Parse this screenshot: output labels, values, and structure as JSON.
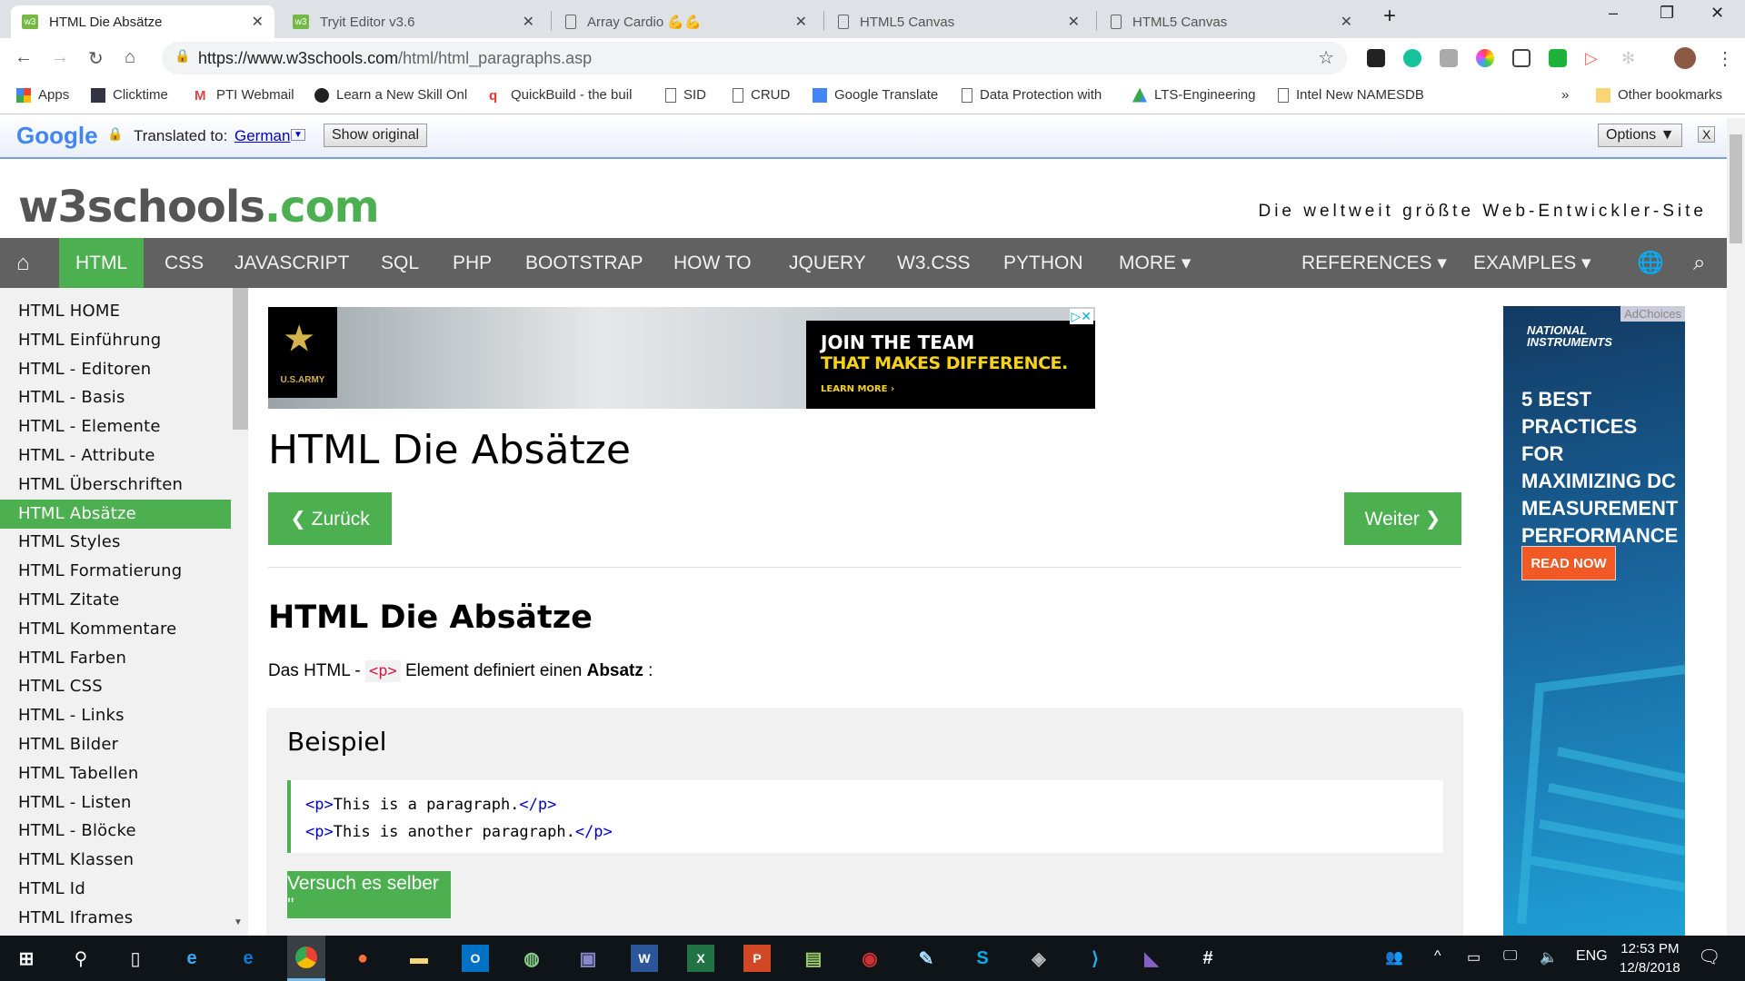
{
  "browser": {
    "tabs": [
      {
        "title": "HTML Die Absätze",
        "favicon": "w3",
        "active": true
      },
      {
        "title": "Tryit Editor v3.6",
        "favicon": "w3"
      },
      {
        "title": "Array Cardio 💪💪",
        "favicon": "page-icon"
      },
      {
        "title": "HTML5 Canvas",
        "favicon": "page-icon"
      },
      {
        "title": "HTML5 Canvas",
        "favicon": "page-icon"
      }
    ],
    "url_host": "https://www.w3schools.com",
    "url_path": "/html/html_paragraphs.asp",
    "bookmarks": [
      "Apps",
      "Clicktime",
      "PTI Webmail",
      "Learn a New Skill Onl",
      "QuickBuild - the buil",
      "SID",
      "CRUD",
      "Google Translate",
      "Data Protection with",
      "LTS-Engineering",
      "Intel New NAMESDB"
    ],
    "bookmarks_more": "»",
    "other_bookmarks": "Other bookmarks"
  },
  "translate": {
    "brand": "Google",
    "label": "Translated to:",
    "language": "German",
    "show_original": "Show original",
    "options": "Options ▼",
    "close": "X"
  },
  "site": {
    "logo_main": "w3schools",
    "logo_tld": ".com",
    "tagline": "Die weltweit größte Web-Entwickler-Site",
    "nav": [
      "HTML",
      "CSS",
      "JAVASCRIPT",
      "SQL",
      "PHP",
      "BOOTSTRAP",
      "HOW TO",
      "JQUERY",
      "W3.CSS",
      "PYTHON",
      "MORE ▾"
    ],
    "nav_right": [
      "REFERENCES ▾",
      "EXAMPLES ▾"
    ],
    "active_nav": "HTML",
    "accent": "#4caf50"
  },
  "sidebar": [
    "HTML HOME",
    "HTML Einführung",
    "HTML - Editoren",
    "HTML - Basis",
    "HTML - Elemente",
    "HTML - Attribute",
    "HTML Überschriften",
    "HTML Absätze",
    "HTML Styles",
    "HTML Formatierung",
    "HTML Zitate",
    "HTML Kommentare",
    "HTML Farben",
    "HTML CSS",
    "HTML - Links",
    "HTML Bilder",
    "HTML Tabellen",
    "HTML - Listen",
    "HTML - Blöcke",
    "HTML Klassen",
    "HTML Id",
    "HTML Iframes"
  ],
  "sidebar_active": 7,
  "ads": {
    "army_line1": "JOIN THE TEAM",
    "army_line2": "THAT MAKES DIFFERENCE.",
    "army_cta": "LEARN MORE ›",
    "army_logo": "U.S.ARMY",
    "ni_brand": "NATIONAL INSTRUMENTS",
    "ni_adchoices": "AdChoices",
    "ni_headline": "5 BEST PRACTICES FOR MAXIMIZING DC MEASUREMENT PERFORMANCE",
    "ni_cta": "READ NOW"
  },
  "main": {
    "title": "HTML Die Absätze",
    "prev": "❮ Zurück",
    "next": "Weiter ❯",
    "heading": "HTML Die Absätze",
    "para_before": "Das HTML - ",
    "para_code": "<p>",
    "para_middle": " Element definiert einen ",
    "para_bold": "Absatz",
    "para_after": " :",
    "example_title": "Beispiel",
    "code_lines": [
      {
        "open": "<p>",
        "text": "This is a paragraph.",
        "close": "</p>"
      },
      {
        "open": "<p>",
        "text": "This is another paragraph.",
        "close": "</p>"
      }
    ],
    "try_button": "Versuch es selber \""
  },
  "taskbar": {
    "time": "12:53 PM",
    "date": "12/8/2018",
    "lang": "ENG"
  }
}
